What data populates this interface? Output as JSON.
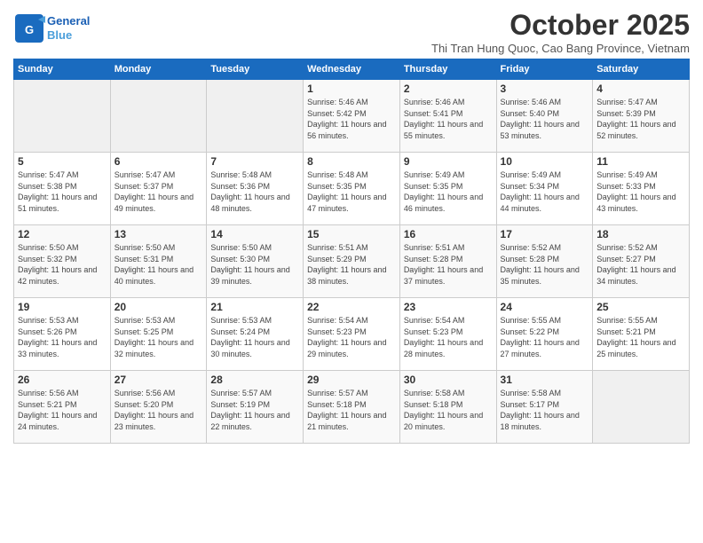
{
  "header": {
    "logo_line1": "General",
    "logo_line2": "Blue",
    "title": "October 2025",
    "subtitle": "Thi Tran Hung Quoc, Cao Bang Province, Vietnam"
  },
  "weekdays": [
    "Sunday",
    "Monday",
    "Tuesday",
    "Wednesday",
    "Thursday",
    "Friday",
    "Saturday"
  ],
  "weeks": [
    [
      {
        "day": "",
        "sunrise": "",
        "sunset": "",
        "daylight": ""
      },
      {
        "day": "",
        "sunrise": "",
        "sunset": "",
        "daylight": ""
      },
      {
        "day": "",
        "sunrise": "",
        "sunset": "",
        "daylight": ""
      },
      {
        "day": "1",
        "sunrise": "Sunrise: 5:46 AM",
        "sunset": "Sunset: 5:42 PM",
        "daylight": "Daylight: 11 hours and 56 minutes."
      },
      {
        "day": "2",
        "sunrise": "Sunrise: 5:46 AM",
        "sunset": "Sunset: 5:41 PM",
        "daylight": "Daylight: 11 hours and 55 minutes."
      },
      {
        "day": "3",
        "sunrise": "Sunrise: 5:46 AM",
        "sunset": "Sunset: 5:40 PM",
        "daylight": "Daylight: 11 hours and 53 minutes."
      },
      {
        "day": "4",
        "sunrise": "Sunrise: 5:47 AM",
        "sunset": "Sunset: 5:39 PM",
        "daylight": "Daylight: 11 hours and 52 minutes."
      }
    ],
    [
      {
        "day": "5",
        "sunrise": "Sunrise: 5:47 AM",
        "sunset": "Sunset: 5:38 PM",
        "daylight": "Daylight: 11 hours and 51 minutes."
      },
      {
        "day": "6",
        "sunrise": "Sunrise: 5:47 AM",
        "sunset": "Sunset: 5:37 PM",
        "daylight": "Daylight: 11 hours and 49 minutes."
      },
      {
        "day": "7",
        "sunrise": "Sunrise: 5:48 AM",
        "sunset": "Sunset: 5:36 PM",
        "daylight": "Daylight: 11 hours and 48 minutes."
      },
      {
        "day": "8",
        "sunrise": "Sunrise: 5:48 AM",
        "sunset": "Sunset: 5:35 PM",
        "daylight": "Daylight: 11 hours and 47 minutes."
      },
      {
        "day": "9",
        "sunrise": "Sunrise: 5:49 AM",
        "sunset": "Sunset: 5:35 PM",
        "daylight": "Daylight: 11 hours and 46 minutes."
      },
      {
        "day": "10",
        "sunrise": "Sunrise: 5:49 AM",
        "sunset": "Sunset: 5:34 PM",
        "daylight": "Daylight: 11 hours and 44 minutes."
      },
      {
        "day": "11",
        "sunrise": "Sunrise: 5:49 AM",
        "sunset": "Sunset: 5:33 PM",
        "daylight": "Daylight: 11 hours and 43 minutes."
      }
    ],
    [
      {
        "day": "12",
        "sunrise": "Sunrise: 5:50 AM",
        "sunset": "Sunset: 5:32 PM",
        "daylight": "Daylight: 11 hours and 42 minutes."
      },
      {
        "day": "13",
        "sunrise": "Sunrise: 5:50 AM",
        "sunset": "Sunset: 5:31 PM",
        "daylight": "Daylight: 11 hours and 40 minutes."
      },
      {
        "day": "14",
        "sunrise": "Sunrise: 5:50 AM",
        "sunset": "Sunset: 5:30 PM",
        "daylight": "Daylight: 11 hours and 39 minutes."
      },
      {
        "day": "15",
        "sunrise": "Sunrise: 5:51 AM",
        "sunset": "Sunset: 5:29 PM",
        "daylight": "Daylight: 11 hours and 38 minutes."
      },
      {
        "day": "16",
        "sunrise": "Sunrise: 5:51 AM",
        "sunset": "Sunset: 5:28 PM",
        "daylight": "Daylight: 11 hours and 37 minutes."
      },
      {
        "day": "17",
        "sunrise": "Sunrise: 5:52 AM",
        "sunset": "Sunset: 5:28 PM",
        "daylight": "Daylight: 11 hours and 35 minutes."
      },
      {
        "day": "18",
        "sunrise": "Sunrise: 5:52 AM",
        "sunset": "Sunset: 5:27 PM",
        "daylight": "Daylight: 11 hours and 34 minutes."
      }
    ],
    [
      {
        "day": "19",
        "sunrise": "Sunrise: 5:53 AM",
        "sunset": "Sunset: 5:26 PM",
        "daylight": "Daylight: 11 hours and 33 minutes."
      },
      {
        "day": "20",
        "sunrise": "Sunrise: 5:53 AM",
        "sunset": "Sunset: 5:25 PM",
        "daylight": "Daylight: 11 hours and 32 minutes."
      },
      {
        "day": "21",
        "sunrise": "Sunrise: 5:53 AM",
        "sunset": "Sunset: 5:24 PM",
        "daylight": "Daylight: 11 hours and 30 minutes."
      },
      {
        "day": "22",
        "sunrise": "Sunrise: 5:54 AM",
        "sunset": "Sunset: 5:23 PM",
        "daylight": "Daylight: 11 hours and 29 minutes."
      },
      {
        "day": "23",
        "sunrise": "Sunrise: 5:54 AM",
        "sunset": "Sunset: 5:23 PM",
        "daylight": "Daylight: 11 hours and 28 minutes."
      },
      {
        "day": "24",
        "sunrise": "Sunrise: 5:55 AM",
        "sunset": "Sunset: 5:22 PM",
        "daylight": "Daylight: 11 hours and 27 minutes."
      },
      {
        "day": "25",
        "sunrise": "Sunrise: 5:55 AM",
        "sunset": "Sunset: 5:21 PM",
        "daylight": "Daylight: 11 hours and 25 minutes."
      }
    ],
    [
      {
        "day": "26",
        "sunrise": "Sunrise: 5:56 AM",
        "sunset": "Sunset: 5:21 PM",
        "daylight": "Daylight: 11 hours and 24 minutes."
      },
      {
        "day": "27",
        "sunrise": "Sunrise: 5:56 AM",
        "sunset": "Sunset: 5:20 PM",
        "daylight": "Daylight: 11 hours and 23 minutes."
      },
      {
        "day": "28",
        "sunrise": "Sunrise: 5:57 AM",
        "sunset": "Sunset: 5:19 PM",
        "daylight": "Daylight: 11 hours and 22 minutes."
      },
      {
        "day": "29",
        "sunrise": "Sunrise: 5:57 AM",
        "sunset": "Sunset: 5:18 PM",
        "daylight": "Daylight: 11 hours and 21 minutes."
      },
      {
        "day": "30",
        "sunrise": "Sunrise: 5:58 AM",
        "sunset": "Sunset: 5:18 PM",
        "daylight": "Daylight: 11 hours and 20 minutes."
      },
      {
        "day": "31",
        "sunrise": "Sunrise: 5:58 AM",
        "sunset": "Sunset: 5:17 PM",
        "daylight": "Daylight: 11 hours and 18 minutes."
      },
      {
        "day": "",
        "sunrise": "",
        "sunset": "",
        "daylight": ""
      }
    ]
  ]
}
